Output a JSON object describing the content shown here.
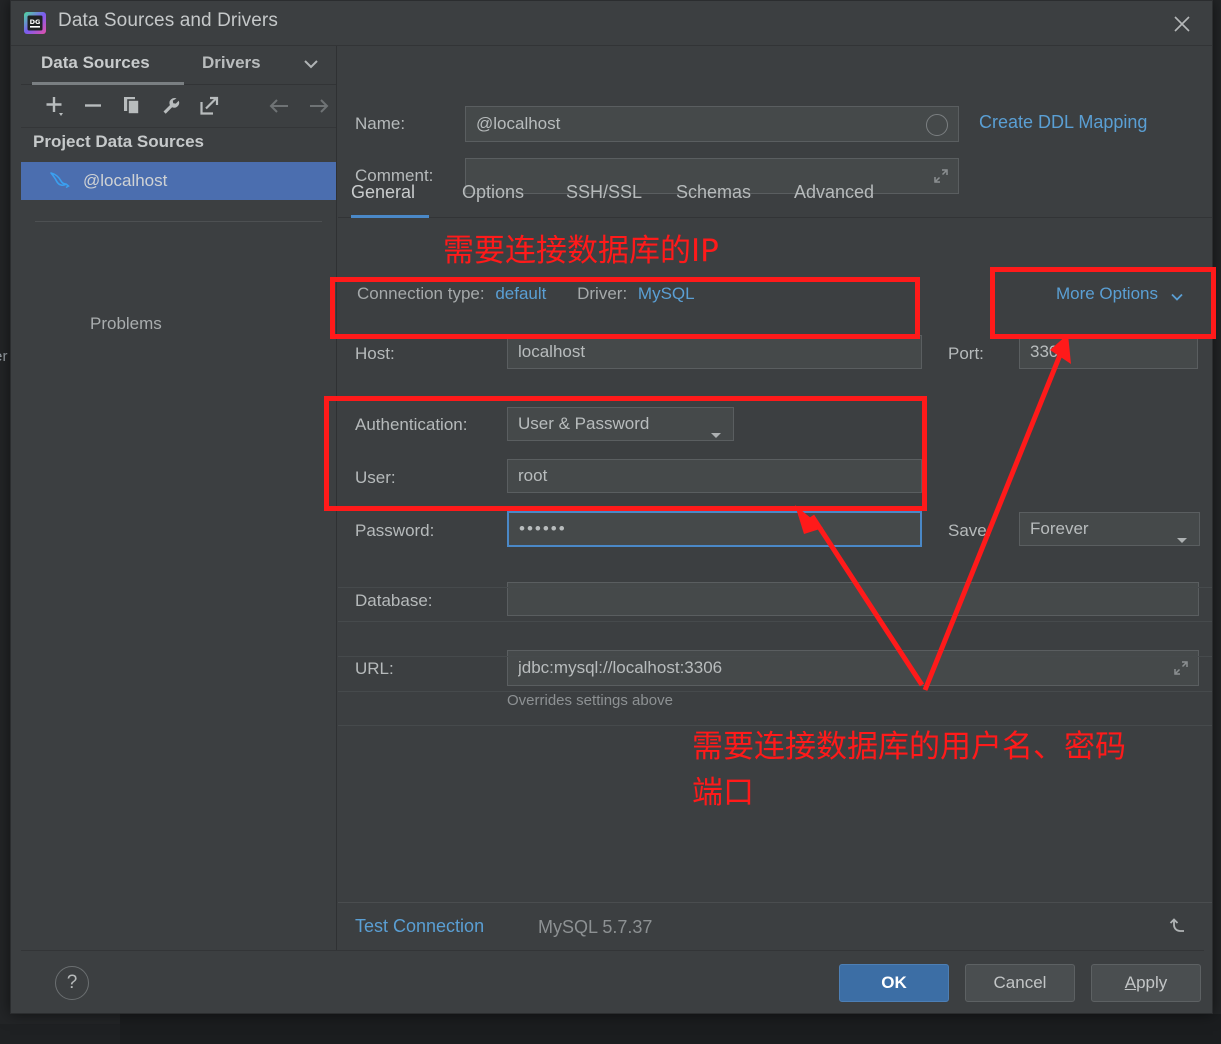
{
  "window": {
    "title": "Data Sources and Drivers",
    "app_icon": "datagrip-icon",
    "close_icon": "close-icon"
  },
  "sidebar": {
    "tabs": [
      {
        "label": "Data Sources",
        "active": true
      },
      {
        "label": "Drivers",
        "active": false
      }
    ],
    "chevron_icon": "chevron-down-icon",
    "toolbar_icons": [
      "add-icon",
      "remove-icon",
      "duplicate-icon",
      "wrench-icon",
      "external-link-icon",
      "back-arrow-icon",
      "forward-arrow-icon"
    ],
    "group_label": "Project Data Sources",
    "data_source": {
      "label": "@localhost",
      "icon": "mysql-dolphin-icon",
      "selected": true
    },
    "problems_label": "Problems"
  },
  "form": {
    "name_label": "Name:",
    "name_value": "@localhost",
    "name_refresh_icon": "circle-refresh-icon",
    "ddl_link": "Create DDL Mapping",
    "comment_label": "Comment:",
    "comment_value": "",
    "comment_expand_icon": "expand-icon",
    "tabs": [
      {
        "label": "General",
        "active": true
      },
      {
        "label": "Options",
        "active": false
      },
      {
        "label": "SSH/SSL",
        "active": false
      },
      {
        "label": "Schemas",
        "active": false
      },
      {
        "label": "Advanced",
        "active": false
      }
    ],
    "connection_type_label": "Connection type:",
    "connection_type_value": "default",
    "driver_label": "Driver:",
    "driver_value": "MySQL",
    "more_options": "More Options",
    "more_options_icon": "chevron-down-icon",
    "host_label": "Host:",
    "host_value": "localhost",
    "port_label": "Port:",
    "port_value": "3306",
    "auth_label": "Authentication:",
    "auth_value": "User & Password",
    "auth_icon": "dropdown-arrow-icon",
    "user_label": "User:",
    "user_value": "root",
    "password_label": "Password:",
    "password_value": "••••••",
    "save_label": "Save:",
    "save_value": "Forever",
    "save_icon": "dropdown-arrow-icon",
    "database_label": "Database:",
    "database_value": "",
    "url_label": "URL:",
    "url_value": "jdbc:mysql://localhost:3306",
    "url_expand_icon": "expand-icon",
    "url_hint": "Overrides settings above"
  },
  "footer": {
    "test_connection": "Test Connection",
    "db_version": "MySQL 5.7.37",
    "revert_icon": "revert-arrow-icon"
  },
  "buttons": {
    "help": "?",
    "ok": "OK",
    "cancel": "Cancel",
    "apply_underlined": "A",
    "apply_rest": "pply"
  },
  "annotations": {
    "color": "#ff1a1a",
    "ip_note": "需要连接数据库的IP",
    "credentials_note_line1": "需要连接数据库的用户名、密码",
    "credentials_note_line2": "端口"
  },
  "background": {
    "partial_text": "er"
  },
  "colors": {
    "panel": "#3c3f41",
    "field": "#45494a",
    "accent_blue": "#4a88c7",
    "link_blue": "#5a9fd4",
    "selection_blue": "#4b6eaf",
    "annotation_red": "#ff1a1a",
    "primary_button": "#3c6ea5"
  }
}
